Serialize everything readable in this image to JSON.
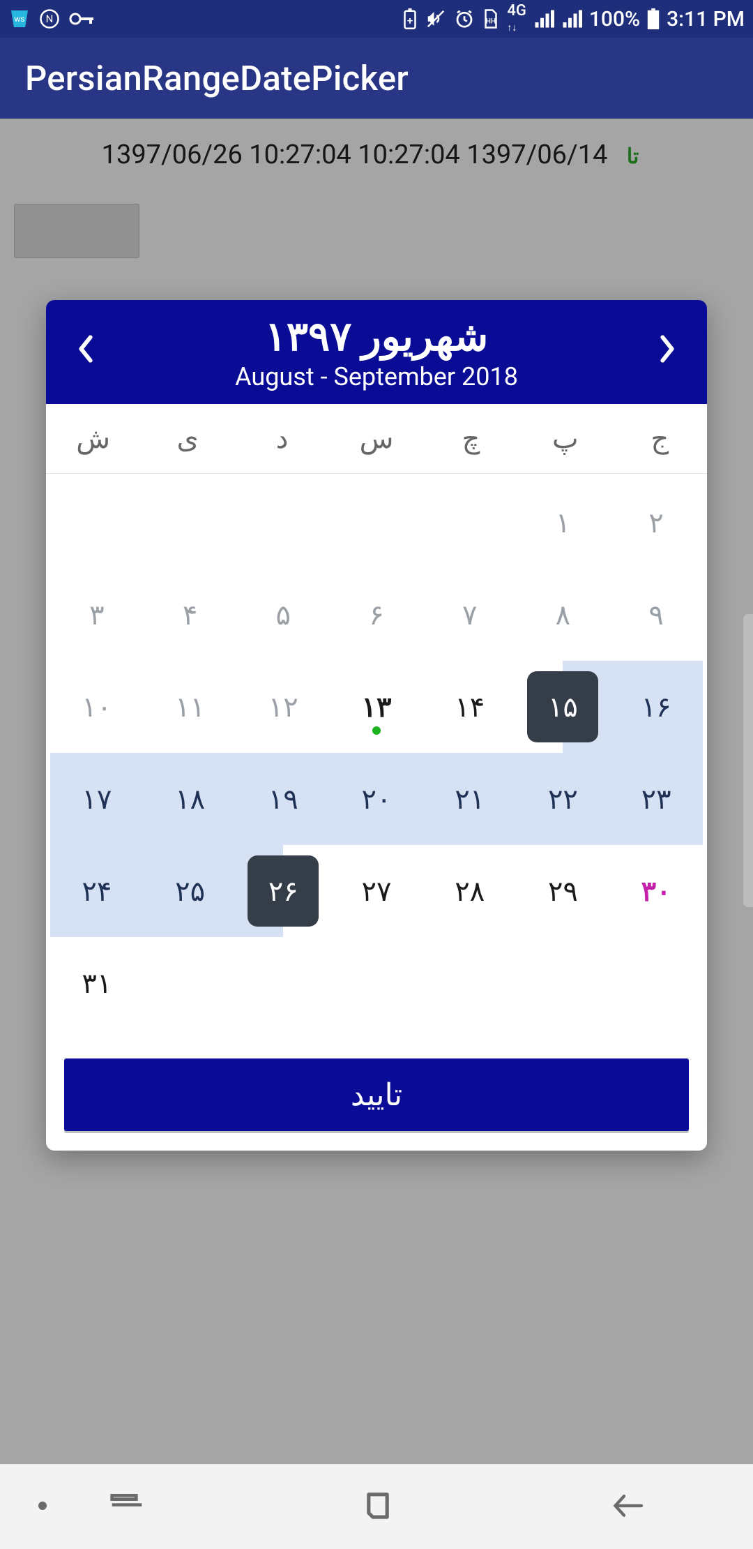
{
  "status": {
    "battery": "100%",
    "time": "3:11 PM",
    "network": "4G"
  },
  "app": {
    "title": "PersianRangeDatePicker"
  },
  "range": {
    "end": "1397/06/26 10:27:04",
    "sep": "تا",
    "start": "1397/06/14 10:27:04"
  },
  "dialog": {
    "month_fa": "شهریور ۱۳۹۷",
    "month_en": "August - September 2018",
    "confirm_label": "تایید",
    "weekdays": [
      "ش",
      "ی",
      "د",
      "س",
      "چ",
      "پ",
      "ج"
    ],
    "days": [
      {
        "n": "",
        "state": ""
      },
      {
        "n": "",
        "state": ""
      },
      {
        "n": "",
        "state": ""
      },
      {
        "n": "",
        "state": ""
      },
      {
        "n": "",
        "state": ""
      },
      {
        "n": "۱",
        "state": "dim"
      },
      {
        "n": "۲",
        "state": "dim"
      },
      {
        "n": "۳",
        "state": "dim"
      },
      {
        "n": "۴",
        "state": "dim"
      },
      {
        "n": "۵",
        "state": "dim"
      },
      {
        "n": "۶",
        "state": "dim"
      },
      {
        "n": "۷",
        "state": "dim"
      },
      {
        "n": "۸",
        "state": "dim"
      },
      {
        "n": "۹",
        "state": "dim"
      },
      {
        "n": "۱۰",
        "state": "dim"
      },
      {
        "n": "۱۱",
        "state": "dim"
      },
      {
        "n": "۱۲",
        "state": "dim"
      },
      {
        "n": "۱۳",
        "state": "today"
      },
      {
        "n": "۱۴",
        "state": "dark"
      },
      {
        "n": "۱۵",
        "state": "endpoint-start"
      },
      {
        "n": "۱۶",
        "state": "range"
      },
      {
        "n": "۱۷",
        "state": "range"
      },
      {
        "n": "۱۸",
        "state": "range"
      },
      {
        "n": "۱۹",
        "state": "range"
      },
      {
        "n": "۲۰",
        "state": "range"
      },
      {
        "n": "۲۱",
        "state": "range"
      },
      {
        "n": "۲۲",
        "state": "range"
      },
      {
        "n": "۲۳",
        "state": "range"
      },
      {
        "n": "۲۴",
        "state": "range"
      },
      {
        "n": "۲۵",
        "state": "range"
      },
      {
        "n": "۲۶",
        "state": "endpoint-end"
      },
      {
        "n": "۲۷",
        "state": "dark"
      },
      {
        "n": "۲۸",
        "state": "dark"
      },
      {
        "n": "۲۹",
        "state": "dark"
      },
      {
        "n": "۳۰",
        "state": "holiday"
      },
      {
        "n": "۳۱",
        "state": "dark"
      },
      {
        "n": "",
        "state": ""
      },
      {
        "n": "",
        "state": ""
      },
      {
        "n": "",
        "state": ""
      },
      {
        "n": "",
        "state": ""
      },
      {
        "n": "",
        "state": ""
      },
      {
        "n": "",
        "state": ""
      }
    ]
  }
}
